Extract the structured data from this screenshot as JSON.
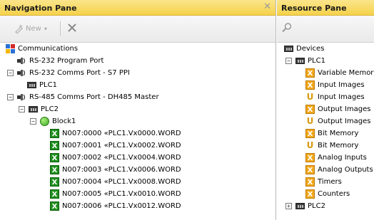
{
  "nav_pane": {
    "title": "Navigation Pane",
    "toolbar": {
      "new_label": "New"
    },
    "tree": [
      {
        "label": "Communications"
      },
      {
        "label": "RS-232 Program Port"
      },
      {
        "label": "RS-232 Comms Port - S7 PPI",
        "expander": "−"
      },
      {
        "label": "PLC1"
      },
      {
        "label": "RS-485 Comms Port - DH485 Master",
        "expander": "−"
      },
      {
        "label": "PLC2",
        "expander": "−"
      },
      {
        "label": "Block1",
        "expander": "−"
      },
      {
        "label": "N007:0000 «PLC1.Vx0000.WORD"
      },
      {
        "label": "N007:0001 «PLC1.Vx0002.WORD"
      },
      {
        "label": "N007:0002 «PLC1.Vx0004.WORD"
      },
      {
        "label": "N007:0003 «PLC1.Vx0006.WORD"
      },
      {
        "label": "N007:0004 «PLC1.Vx0008.WORD"
      },
      {
        "label": "N007:0005 «PLC1.Vx0010.WORD"
      },
      {
        "label": "N007:0006 «PLC1.Vx0012.WORD"
      }
    ]
  },
  "resource_pane": {
    "title": "Resource Pane",
    "tree": [
      {
        "label": "Devices"
      },
      {
        "label": "PLC1",
        "expander": "−"
      },
      {
        "label": "Variable Memory"
      },
      {
        "label": "Input Images"
      },
      {
        "label": "Input Images"
      },
      {
        "label": "Output Images"
      },
      {
        "label": "Output Images"
      },
      {
        "label": "Bit Memory"
      },
      {
        "label": "Bit Memory"
      },
      {
        "label": "Analog Inputs"
      },
      {
        "label": "Analog Outputs"
      },
      {
        "label": "Timers"
      },
      {
        "label": "Counters"
      },
      {
        "label": "PLC2",
        "expander": "+"
      }
    ]
  }
}
